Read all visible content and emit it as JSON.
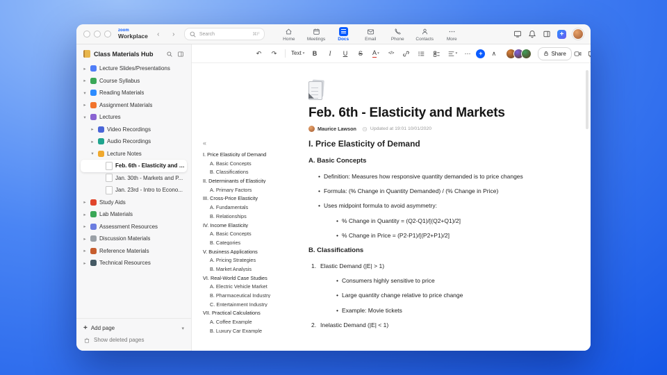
{
  "topbar": {
    "brand_top": "zoom",
    "brand_bottom": "Workplace",
    "back_glyph": "‹",
    "forward_glyph": "›",
    "search_placeholder": "Search",
    "search_shortcut": "⌘F",
    "tabs": [
      {
        "label": "Home",
        "icon": "home",
        "active": false
      },
      {
        "label": "Meetings",
        "icon": "calendar",
        "active": false
      },
      {
        "label": "Docs",
        "icon": "docpage",
        "active": true
      },
      {
        "label": "Email",
        "icon": "mail",
        "active": false
      },
      {
        "label": "Phone",
        "icon": "phone",
        "active": false
      },
      {
        "label": "Contacts",
        "icon": "person",
        "active": false
      },
      {
        "label": "More",
        "icon": "dots",
        "active": false
      }
    ],
    "right_buttons": [
      {
        "name": "screen-share-icon",
        "svg": "monitor"
      },
      {
        "name": "notifications-bell-icon",
        "svg": "bell"
      },
      {
        "name": "side-panel-icon",
        "svg": "panel"
      },
      {
        "name": "create-new-button",
        "glyph": "+",
        "cls": "plusblue-top"
      },
      {
        "name": "profile-avatar",
        "avatar": true
      }
    ]
  },
  "sidebar": {
    "title": "Class Materials Hub",
    "items": [
      {
        "label": "Lecture Slides/Presentations",
        "level": 0,
        "chevron": "right",
        "kind": "color",
        "color": "#4f7df7",
        "icon_name": "presentation-icon"
      },
      {
        "label": "Course Syllabus",
        "level": 0,
        "chevron": "right",
        "kind": "color",
        "color": "#3aa757",
        "icon_name": "syllabus-icon"
      },
      {
        "label": "Reading Materials",
        "level": 0,
        "chevron": "down",
        "kind": "color",
        "color": "#2d8cff",
        "icon_name": "book-icon"
      },
      {
        "label": "Assignment Materials",
        "level": 0,
        "chevron": "right",
        "kind": "color",
        "color": "#f2742c",
        "icon_name": "assignment-icon"
      },
      {
        "label": "Lectures",
        "level": 0,
        "chevron": "down",
        "kind": "color",
        "color": "#8a63d2",
        "icon_name": "lectures-tag-icon"
      },
      {
        "label": "Video Recordings",
        "level": 1,
        "chevron": "right",
        "kind": "color",
        "color": "#4a66d8",
        "icon_name": "video-recordings-icon"
      },
      {
        "label": "Audio Recordings",
        "level": 1,
        "chevron": "right",
        "kind": "color",
        "color": "#1fa48e",
        "icon_name": "audio-recordings-icon"
      },
      {
        "label": "Lecture Notes",
        "level": 1,
        "chevron": "down",
        "kind": "color",
        "color": "#f0a92e",
        "icon_name": "lecture-notes-icon"
      },
      {
        "label": "Feb. 6th - Elasticity and M...",
        "level": 2,
        "chevron": "",
        "kind": "page",
        "icon_name": "page-icon",
        "selected": true
      },
      {
        "label": "Jan. 30th - Markets and P...",
        "level": 2,
        "chevron": "",
        "kind": "page",
        "icon_name": "page-icon",
        "selected": false
      },
      {
        "label": "Jan. 23rd - Intro to Econo...",
        "level": 2,
        "chevron": "",
        "kind": "page",
        "icon_name": "page-icon",
        "selected": false
      },
      {
        "label": "Study Aids",
        "level": 0,
        "chevron": "right",
        "kind": "color",
        "color": "#e0452c",
        "icon_name": "study-aids-icon"
      },
      {
        "label": "Lab Materials",
        "level": 0,
        "chevron": "right",
        "kind": "color",
        "color": "#3aa757",
        "icon_name": "lab-materials-icon"
      },
      {
        "label": "Assessment Resources",
        "level": 0,
        "chevron": "right",
        "kind": "color",
        "color": "#6b7de0",
        "icon_name": "assessment-icon"
      },
      {
        "label": "Discussion Materials",
        "level": 0,
        "chevron": "right",
        "kind": "color",
        "color": "#9aa0a6",
        "icon_name": "discussion-icon"
      },
      {
        "label": "Reference Materials",
        "level": 0,
        "chevron": "right",
        "kind": "color",
        "color": "#c65d2e",
        "icon_name": "reference-icon"
      },
      {
        "label": "Technical Resources",
        "level": 0,
        "chevron": "right",
        "kind": "color",
        "color": "#455a64",
        "icon_name": "technical-icon"
      }
    ],
    "add_page_plus": "+",
    "add_page_label": "Add page",
    "add_page_caret": "▾",
    "show_deleted_label": "Show deleted pages"
  },
  "toolbar": {
    "buttons": [
      {
        "name": "undo",
        "glyph": "↶"
      },
      {
        "name": "redo",
        "glyph": "↷"
      },
      {
        "name": "div1",
        "divider": true
      },
      {
        "name": "text-style",
        "glyph": "Text",
        "cls": "textstyle",
        "dropdown": true
      },
      {
        "name": "bold",
        "glyph": "B",
        "cls": "bold"
      },
      {
        "name": "italic",
        "glyph": "I",
        "cls": "italic"
      },
      {
        "name": "underline",
        "glyph": "U",
        "cls": "under"
      },
      {
        "name": "strikethrough",
        "glyph": "S",
        "cls": "strike"
      },
      {
        "name": "text-color",
        "glyph": "A",
        "cls": "colorA",
        "dropdown": true
      },
      {
        "name": "code",
        "glyph": "</>",
        "cls": "code"
      },
      {
        "name": "link",
        "svg": "link"
      },
      {
        "name": "bullet-list",
        "svg": "list"
      },
      {
        "name": "checklist",
        "svg": "check"
      },
      {
        "name": "align",
        "svg": "align",
        "dropdown": true
      },
      {
        "name": "more-formatting",
        "glyph": "⋯"
      },
      {
        "name": "insert-block",
        "glyph": "+",
        "cls": "plusblue"
      },
      {
        "name": "collapse-toolbar",
        "glyph": "∧"
      }
    ],
    "avatars": [
      "#d9813b",
      "#7b61e0",
      "#3f9d5a"
    ],
    "share_label": "Share",
    "right_buttons": [
      {
        "name": "start-video-icon",
        "svg": "video"
      },
      {
        "name": "comments-icon",
        "svg": "comment"
      },
      {
        "name": "language-globe-icon",
        "svg": "globe"
      },
      {
        "name": "more-options-icon",
        "glyph": "⋯"
      }
    ]
  },
  "outline": {
    "collapse_glyph": "«",
    "items": [
      {
        "text": "I. Price Elasticity of Demand",
        "level": 1
      },
      {
        "text": "A. Basic Concepts",
        "level": 2
      },
      {
        "text": "B. Classifications",
        "level": 2
      },
      {
        "text": "II. Determinants of Elasticity",
        "level": 1
      },
      {
        "text": "A. Primary Factors",
        "level": 2
      },
      {
        "text": "III. Cross-Price Elasticity",
        "level": 1
      },
      {
        "text": "A. Fundamentals",
        "level": 2
      },
      {
        "text": "B. Relationships",
        "level": 2
      },
      {
        "text": "IV. Income Elasticity",
        "level": 1
      },
      {
        "text": "A. Basic Concepts",
        "level": 2
      },
      {
        "text": "B. Categories",
        "level": 2
      },
      {
        "text": "V. Business Applications",
        "level": 1
      },
      {
        "text": "A. Pricing Strategies",
        "level": 2
      },
      {
        "text": "B. Market Analysis",
        "level": 2
      },
      {
        "text": "VI. Real-World Case Studies",
        "level": 1
      },
      {
        "text": "A. Electric Vehicle Market",
        "level": 2
      },
      {
        "text": "B. Pharmaceutical Industry",
        "level": 2
      },
      {
        "text": "C. Entertainment Industry",
        "level": 2
      },
      {
        "text": "VII. Practical Calculations",
        "level": 1
      },
      {
        "text": "A. Coffee Example",
        "level": 2
      },
      {
        "text": "B. Luxury Car Example",
        "level": 2
      }
    ]
  },
  "doc": {
    "title": "Feb. 6th - Elasticity and Markets",
    "author": "Maurice Lawson",
    "updated": "Updated at 19:01 10/01/2020",
    "blocks": [
      {
        "type": "h2",
        "text": "I. Price Elasticity of Demand"
      },
      {
        "type": "h3",
        "text": "A. Basic Concepts"
      },
      {
        "type": "b1",
        "text": "Definition: Measures how responsive quantity demanded is to price changes"
      },
      {
        "type": "b1",
        "text": "Formula: (% Change in Quantity Demanded) / (% Change in Price)"
      },
      {
        "type": "b1",
        "text": "Uses midpoint formula to avoid asymmetry:"
      },
      {
        "type": "b2",
        "text": "% Change in Quantity = (Q2-Q1)/[(Q2+Q1)/2]"
      },
      {
        "type": "b2",
        "text": "% Change in Price = (P2-P1)/[(P2+P1)/2]"
      },
      {
        "type": "h3",
        "text": "B. Classifications"
      },
      {
        "type": "n1",
        "num": "1.",
        "text": "Elastic Demand (|E| > 1)"
      },
      {
        "type": "b2",
        "text": "Consumers highly sensitive to price"
      },
      {
        "type": "b2",
        "text": "Large quantity change relative to price change"
      },
      {
        "type": "b2",
        "text": "Example: Movie tickets"
      },
      {
        "type": "n1",
        "num": "2.",
        "text": "Inelastic Demand (|E| < 1)"
      }
    ]
  },
  "colors": {
    "accent": "#0b5cff"
  }
}
